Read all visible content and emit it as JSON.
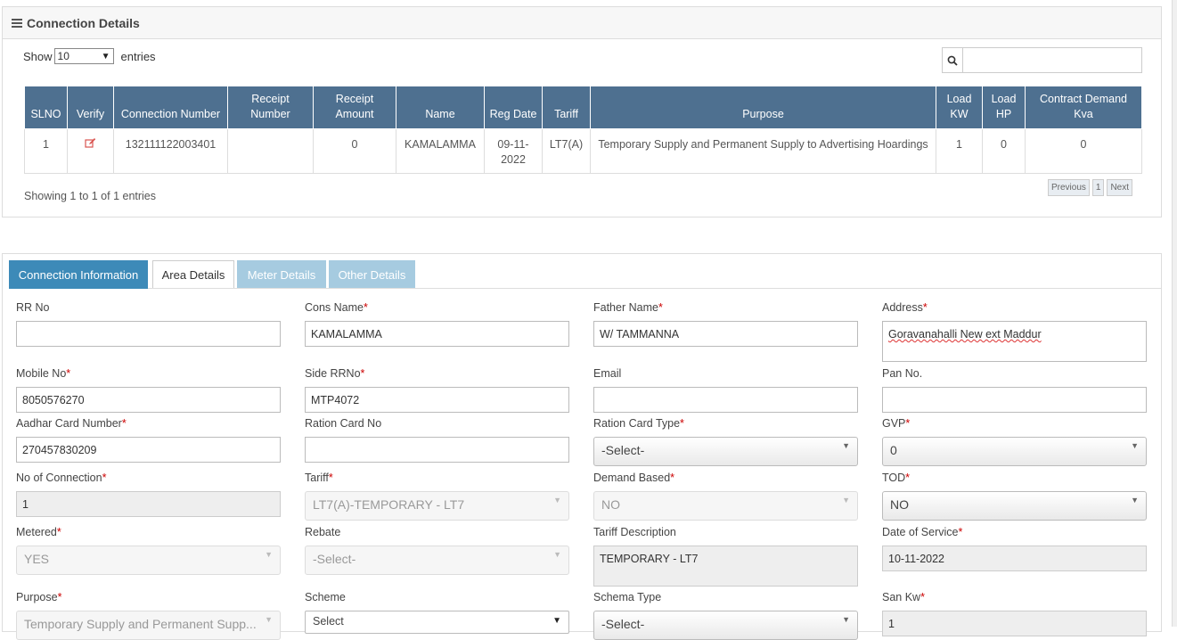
{
  "connection_panel": {
    "title": "Connection Details",
    "show_label": "Show",
    "entries_label": "entries",
    "page_length": "10",
    "search_value": "",
    "table": {
      "headers": [
        "SLNO",
        "Verify",
        "Connection Number",
        "Receipt Number",
        "Receipt Amount",
        "Name",
        "Reg Date",
        "Tariff",
        "Purpose",
        "Load KW",
        "Load HP",
        "Contract Demand Kva"
      ],
      "rows": [
        {
          "slno": "1",
          "connection_number": "132111122003401",
          "receipt_number": "",
          "receipt_amount": "0",
          "name": "KAMALAMMA",
          "reg_date": "09-11-2022",
          "tariff": "LT7(A)",
          "purpose": "Temporary Supply and Permanent Supply to Advertising Hoardings",
          "load_kw": "1",
          "load_hp": "0",
          "contract_demand": "0"
        }
      ]
    },
    "info": "Showing 1 to 1 of 1 entries",
    "pager": {
      "previous": "Previous",
      "page": "1",
      "next": "Next"
    }
  },
  "tabs": [
    "Connection Information",
    "Area Details",
    "Meter Details",
    "Other Details"
  ],
  "form": {
    "rr_no": {
      "label": "RR No",
      "value": ""
    },
    "cons_name": {
      "label": "Cons Name",
      "value": "KAMALAMMA"
    },
    "father_name": {
      "label": "Father Name",
      "value": "W/ TAMMANNA"
    },
    "address": {
      "label": "Address",
      "value": "Goravanahalli New ext Maddur"
    },
    "mobile_no": {
      "label": "Mobile No",
      "value": "8050576270"
    },
    "side_rrno": {
      "label": "Side RRNo",
      "value": "MTP4072"
    },
    "email": {
      "label": "Email",
      "value": ""
    },
    "pan_no": {
      "label": "Pan No.",
      "value": ""
    },
    "aadhar": {
      "label": "Aadhar Card Number",
      "value": "270457830209"
    },
    "ration_card_no": {
      "label": "Ration Card No",
      "value": ""
    },
    "ration_card_type": {
      "label": "Ration Card Type",
      "value": "-Select-"
    },
    "gvp": {
      "label": "GVP",
      "value": "0"
    },
    "no_of_connection": {
      "label": "No of Connection",
      "value": "1"
    },
    "tariff": {
      "label": "Tariff",
      "value": "LT7(A)-TEMPORARY - LT7"
    },
    "demand_based": {
      "label": "Demand Based",
      "value": "NO"
    },
    "tod": {
      "label": "TOD",
      "value": "NO"
    },
    "metered": {
      "label": "Metered",
      "value": "YES"
    },
    "rebate": {
      "label": "Rebate",
      "value": "-Select-"
    },
    "tariff_description": {
      "label": "Tariff Description",
      "value": "TEMPORARY - LT7"
    },
    "date_of_service": {
      "label": "Date of Service",
      "value": "10-11-2022"
    },
    "purpose": {
      "label": "Purpose",
      "value": "Temporary Supply and Permanent Supp..."
    },
    "scheme": {
      "label": "Scheme",
      "value": "Select"
    },
    "schema_type": {
      "label": "Schema Type",
      "value": "-Select-"
    },
    "san_kw": {
      "label": "San Kw",
      "value": "1"
    }
  }
}
